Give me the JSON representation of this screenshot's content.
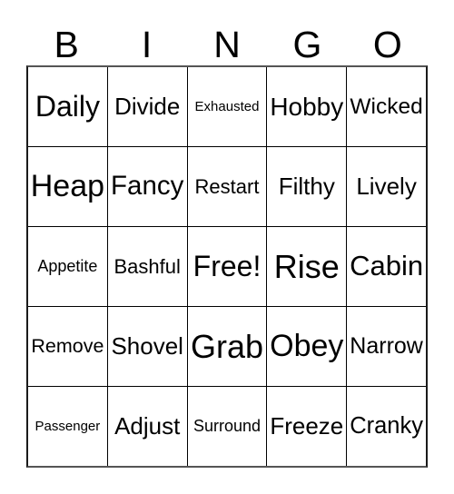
{
  "card": {
    "header": {
      "letters": [
        "B",
        "I",
        "N",
        "G",
        "O"
      ]
    },
    "free_space_label": "Free!",
    "colors": {
      "background": "#ffffff",
      "text": "#000000",
      "grid_line": "#000000",
      "outer_frame": "#555555"
    },
    "grid": {
      "columns": 5,
      "rows": 5,
      "cells": [
        [
          {
            "text": "Daily"
          },
          {
            "text": "Divide"
          },
          {
            "text": "Exhausted"
          },
          {
            "text": "Hobby"
          },
          {
            "text": "Wicked"
          }
        ],
        [
          {
            "text": "Heap"
          },
          {
            "text": "Fancy"
          },
          {
            "text": "Restart"
          },
          {
            "text": "Filthy"
          },
          {
            "text": "Lively"
          }
        ],
        [
          {
            "text": "Appetite"
          },
          {
            "text": "Bashful"
          },
          {
            "text": "Free!"
          },
          {
            "text": "Rise"
          },
          {
            "text": "Cabin"
          }
        ],
        [
          {
            "text": "Remove"
          },
          {
            "text": "Shovel"
          },
          {
            "text": "Grab"
          },
          {
            "text": "Obey"
          },
          {
            "text": "Narrow"
          }
        ],
        [
          {
            "text": "Passenger"
          },
          {
            "text": "Adjust"
          },
          {
            "text": "Surround"
          },
          {
            "text": "Freeze"
          },
          {
            "text": "Cranky"
          }
        ]
      ]
    }
  }
}
